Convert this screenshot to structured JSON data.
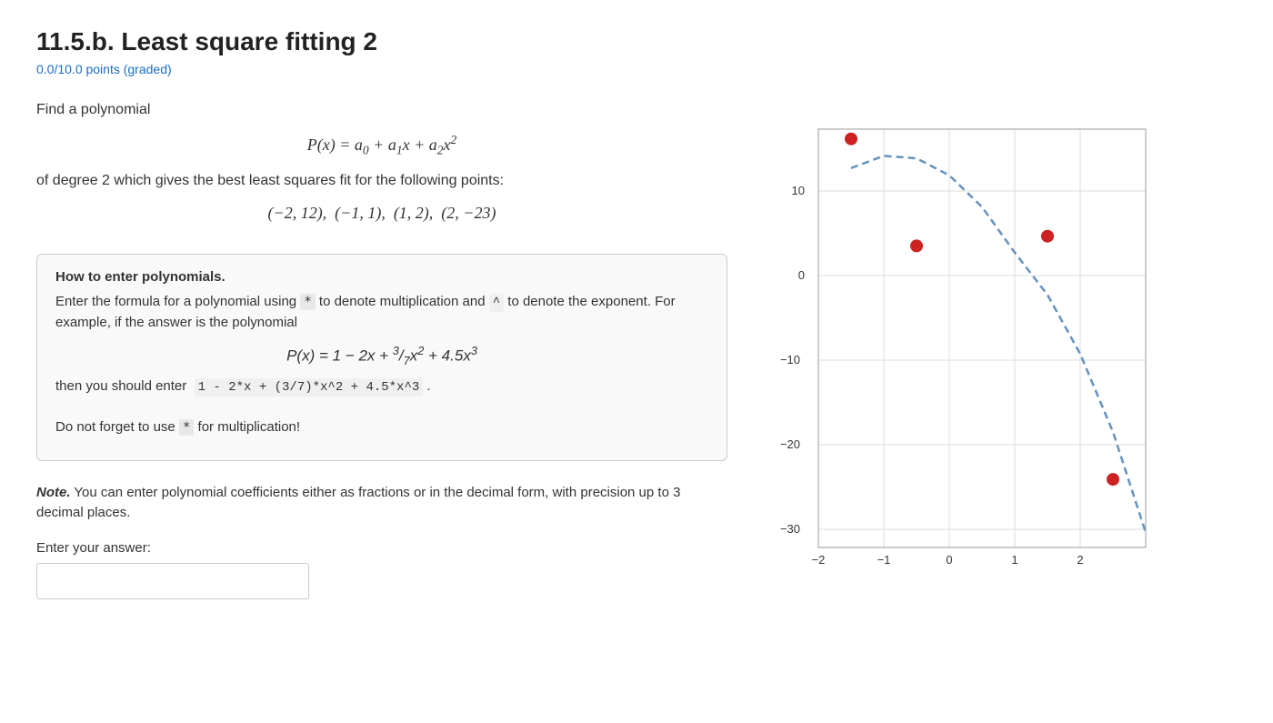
{
  "title": "11.5.b. Least square fitting 2",
  "score": "0.0/10.0 points (graded)",
  "intro1": "Find a polynomial",
  "formula_main": "P(x) = a₀ + a₁x + a₂x²",
  "intro2": "of degree 2 which gives the best least squares fit for the following points:",
  "points": "(−2, 12),  (−1, 1),  (1, 2),  (2, −23)",
  "hint": {
    "title": "How to enter polynomials.",
    "line1_pre": "Enter the formula for a polynomial using",
    "star": "*",
    "line1_mid": "to denote multiplication and",
    "caret": "^",
    "line1_post": "to",
    "line2": "denote the exponent. For example, if the answer is the polynomial",
    "example_formula": "P(x) = 1 − 2x + (3/7)x² + 4.5x³",
    "then_label": "then you should enter",
    "entry_code": "1 - 2*x + (3/7)*x^2 + 4.5*x^3",
    "reminder_pre": "Do not forget to use",
    "reminder_star": "*",
    "reminder_post": "for multiplication!"
  },
  "note": "You can enter polynomial coefficients either as fractions or in the decimal form, with precision up to 3 decimal places.",
  "answer_label": "Enter your answer:",
  "answer_placeholder": "",
  "graph": {
    "points": [
      {
        "x": -2,
        "y": 12,
        "label": "(-2,12)"
      },
      {
        "x": -1,
        "y": 1,
        "label": "(-1,1)"
      },
      {
        "x": 1,
        "y": 2,
        "label": "(1,2)"
      },
      {
        "x": 2,
        "y": -23,
        "label": "(2,-23)"
      }
    ],
    "xmin": -2.5,
    "xmax": 2.5,
    "ymin": -30,
    "ymax": 13,
    "xticks": [
      -2,
      -1,
      0,
      1,
      2
    ],
    "yticks": [
      -30,
      -20,
      -10,
      0,
      10
    ],
    "curve_label": "fitted polynomial"
  }
}
